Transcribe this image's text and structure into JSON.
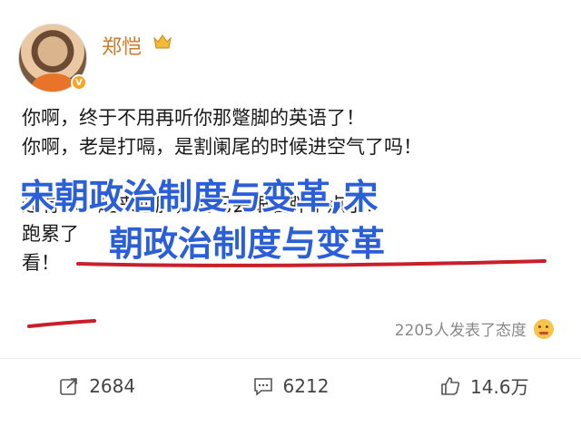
{
  "post": {
    "username": "郑恺",
    "verified_badge": "V",
    "lines": [
      "你啊，终于不用再听你那蹩脚的英语了！",
      "你啊，老是打嗝，是割阑尾的时候进空气了吗！",
      "",
      "还有你，越来越胖，嘴巴会跟着胖了点了！",
      "跑累了",
      "看！"
    ],
    "overlay_line1": "宋朝政治制度与变革,宋",
    "overlay_line2": "朝政治制度与变革",
    "reactions_text": "2205人发表了态度"
  },
  "actions": {
    "share_count": "2684",
    "comment_count": "6212",
    "like_count": "14.6万"
  },
  "colors": {
    "username": "#c97a2b",
    "overlay_text": "#2a5fd8",
    "underline": "#c8202a"
  },
  "icons": [
    "crown-icon",
    "verified-badge-icon",
    "share-icon",
    "comment-icon",
    "like-icon",
    "emoji-icon"
  ]
}
